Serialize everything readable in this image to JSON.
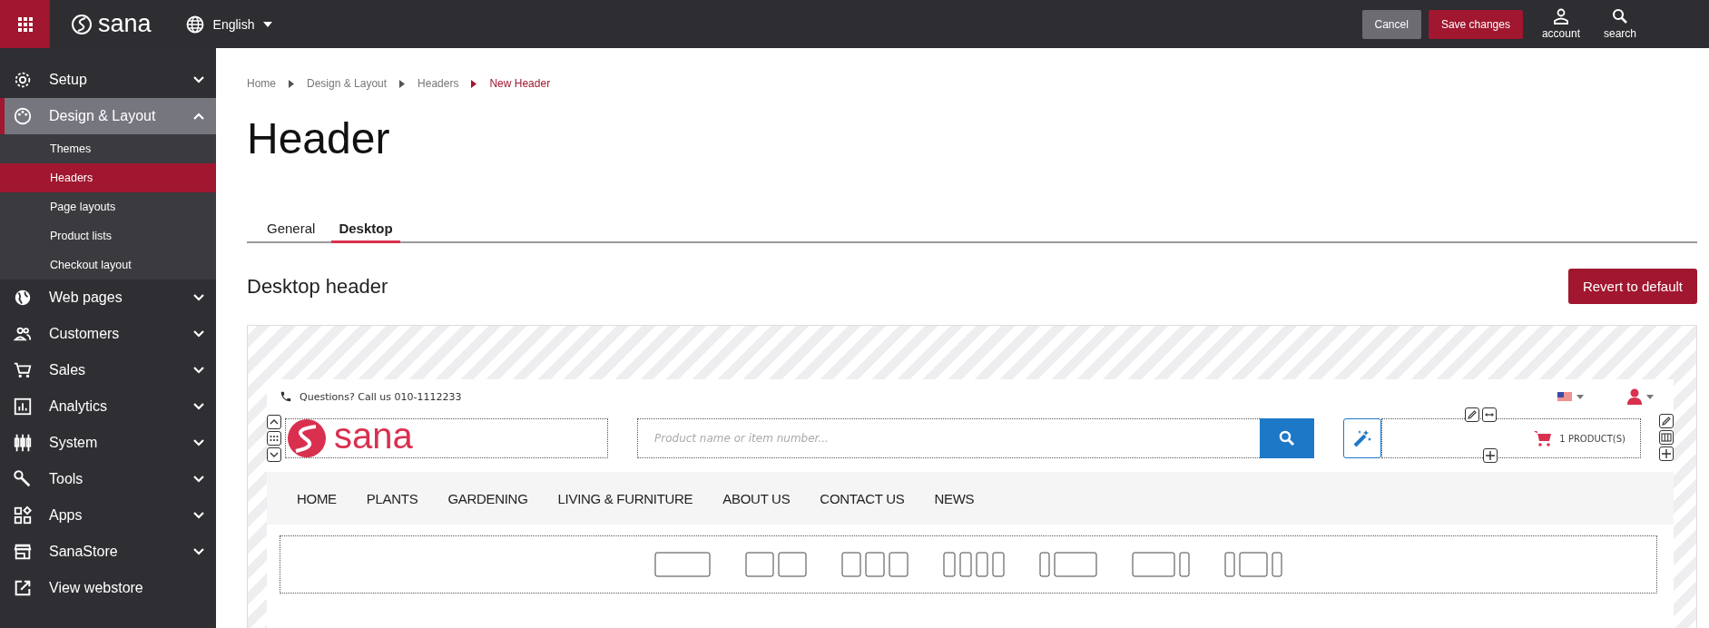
{
  "topbar": {
    "logo": "sana",
    "language": "English",
    "buttons": [
      {
        "label": "Cancel",
        "kind": "secondary"
      },
      {
        "label": "Save changes",
        "kind": "primary"
      }
    ],
    "actions": [
      {
        "label": "account",
        "kind": "account"
      },
      {
        "label": "search",
        "kind": "search"
      }
    ]
  },
  "sidebar": {
    "items": [
      {
        "label": "Setup",
        "kind": "menu",
        "expanded": false
      },
      {
        "label": "Design & Layout",
        "kind": "menu",
        "expanded": true,
        "children": [
          {
            "label": "Themes",
            "selected": false
          },
          {
            "label": "Headers",
            "selected": true
          },
          {
            "label": "Page layouts",
            "selected": false
          },
          {
            "label": "Product lists",
            "selected": false
          },
          {
            "label": "Checkout layout",
            "selected": false
          }
        ]
      },
      {
        "label": "Web pages",
        "kind": "menu",
        "expanded": false
      },
      {
        "label": "Customers",
        "kind": "menu",
        "expanded": false
      },
      {
        "label": "Sales",
        "kind": "menu",
        "expanded": false
      },
      {
        "label": "Analytics",
        "kind": "menu",
        "expanded": false
      },
      {
        "label": "System",
        "kind": "menu",
        "expanded": false
      },
      {
        "label": "Tools",
        "kind": "menu",
        "expanded": false
      },
      {
        "label": "Apps",
        "kind": "menu",
        "expanded": false
      },
      {
        "label": "SanaStore",
        "kind": "menu",
        "expanded": false
      },
      {
        "label": "View webstore",
        "kind": "link"
      }
    ]
  },
  "breadcrumbs": [
    {
      "label": "Home",
      "current": false
    },
    {
      "label": "Design & Layout",
      "current": false
    },
    {
      "label": "Headers",
      "current": false
    },
    {
      "label": "New Header",
      "current": true
    }
  ],
  "title": "Header",
  "tabs": [
    {
      "label": "General",
      "selected": false
    },
    {
      "label": "Desktop",
      "selected": true
    }
  ],
  "section_title": "Desktop header",
  "revert_button": "Revert to default",
  "preview": {
    "contact": "Questions? Call us 010-1112233",
    "logo": "sana",
    "search_placeholder": "Product name or item number...",
    "cart": "1 PRODUCT(S)",
    "menu": [
      "HOME",
      "PLANTS",
      "GARDENING",
      "LIVING & FURNITURE",
      "ABOUT US",
      "CONTACT US",
      "NEWS"
    ]
  }
}
